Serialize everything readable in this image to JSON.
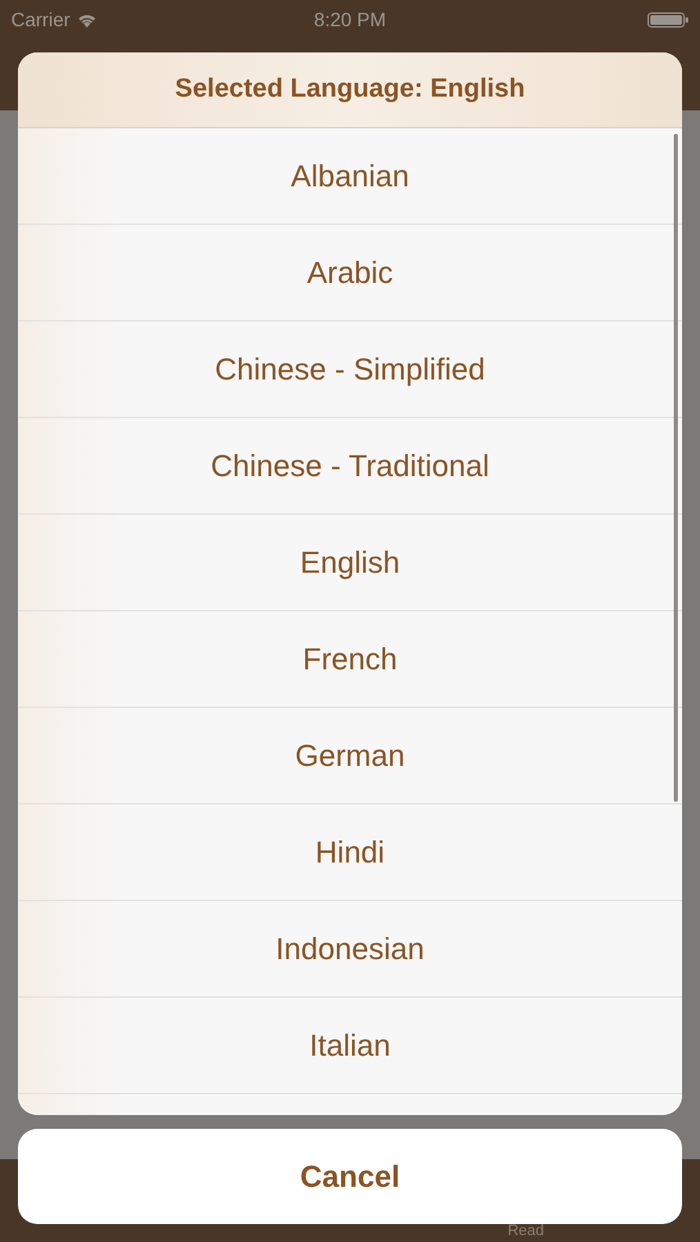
{
  "status_bar": {
    "carrier": "Carrier",
    "time": "8:20 PM"
  },
  "tab_bar": {
    "items": [
      "Read"
    ]
  },
  "sheet": {
    "title": "Selected Language: English",
    "options": [
      "Albanian",
      "Arabic",
      "Chinese - Simplified",
      "Chinese - Traditional",
      "English",
      "French",
      "German",
      "Hindi",
      "Indonesian",
      "Italian"
    ],
    "cancel": "Cancel"
  }
}
